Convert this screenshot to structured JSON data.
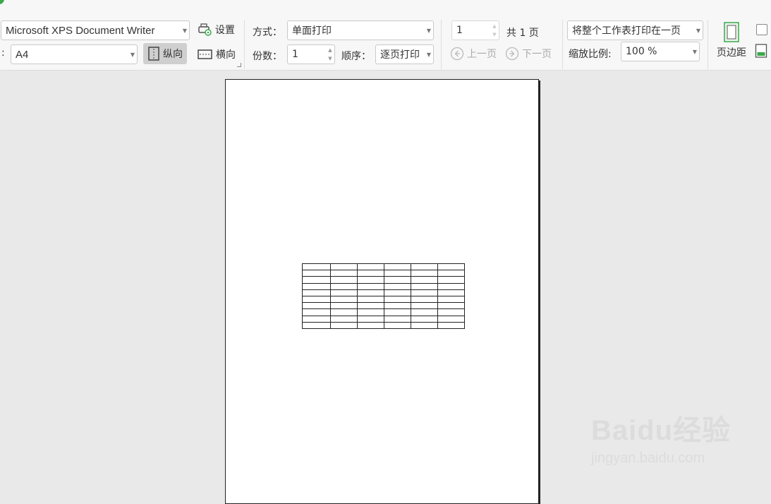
{
  "toolbar": {
    "printer": "Microsoft XPS Document Writer",
    "settings_label": "设置",
    "paper_label_colon": ":",
    "paper_size": "A4",
    "portrait_label": "纵向",
    "landscape_label": "横向",
    "mode_label": "方式：",
    "mode_value": "单面打印",
    "copies_label": "份数：",
    "copies_value": "1",
    "order_label": "顺序：",
    "order_value": "逐页打印",
    "page_number": "1",
    "total_pages": "共 1 页",
    "prev_page": "上一页",
    "next_page": "下一页",
    "fit_option": "将整个工作表打印在一页",
    "zoom_label": "缩放比例:",
    "zoom_value": "100 %",
    "margins_label": "页边距"
  },
  "preview": {
    "table_rows": 10,
    "table_cols": 6
  },
  "watermark": {
    "brand": "Baidu经验",
    "url": "jingyan.baidu.com"
  },
  "colors": {
    "accent_green": "#3aa84b",
    "toolbar_bg": "#f7f7f7",
    "workspace_bg": "#e9e9e9"
  }
}
